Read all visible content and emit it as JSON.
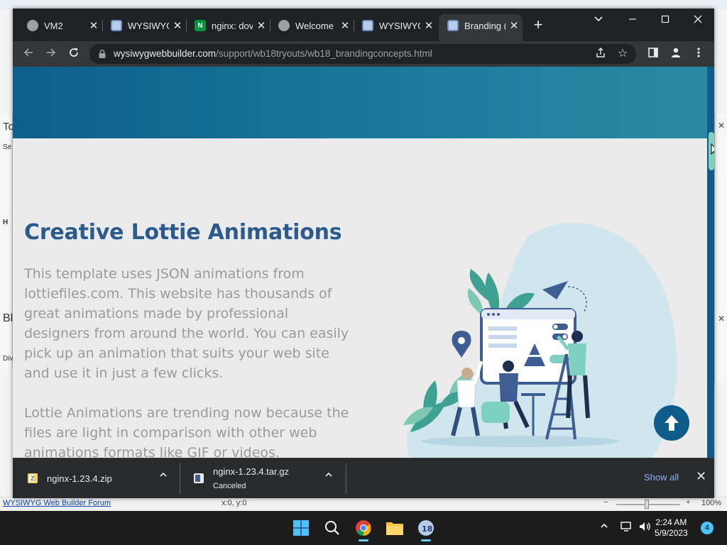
{
  "window": {
    "minimize_icon": "minimize-icon",
    "maximize_icon": "maximize-icon",
    "close_icon": "close-icon"
  },
  "tabs": [
    {
      "title": "VM2",
      "favicon": "globe-icon",
      "active": false
    },
    {
      "title": "WYSIWYG",
      "favicon": "wysiwyg-icon",
      "active": false
    },
    {
      "title": "nginx: dov",
      "favicon": "nginx-icon",
      "active": false
    },
    {
      "title": "Welcome",
      "favicon": "globe-icon",
      "active": false
    },
    {
      "title": "WYSIWYG",
      "favicon": "wysiwyg-icon",
      "active": false
    },
    {
      "title": "Branding (",
      "favicon": "wysiwyg-icon",
      "active": true
    }
  ],
  "toolbar": {
    "url_host": "wysiwygwebbuilder.com",
    "url_path": "/support/wb18tryouts/wb18_brandingconcepts.html"
  },
  "page": {
    "heading": "Creative Lottie Animations",
    "paragraph1": "This template uses JSON animations from lottiefiles.com. This website has thousands of great animations made by professional designers from around the world. You can easily pick up an animation that suits your web site and use it in just a few clicks.",
    "paragraph2": "Lottie Animations are trending now because the files are light in comparison with other web animations formats like GIF or videos."
  },
  "downloads": [
    {
      "filename": "nginx-1.23.4.zip",
      "status": ""
    },
    {
      "filename": "nginx-1.23.4.tar.gz",
      "status": "Canceled"
    }
  ],
  "downloads_show_all": "Show all",
  "background_app": {
    "forum_link": "WYSIWYG Web Builder Forum",
    "coords": "x:0, y:0",
    "zoom": "100%",
    "left_labels": [
      "To",
      "Se",
      "H",
      "Bl",
      "Div"
    ]
  },
  "taskbar": {
    "time": "2:24 AM",
    "date": "5/9/2023",
    "notification_count": "4",
    "colors": {
      "accent": "#60cdff"
    }
  },
  "colors": {
    "heading": "#2b5a8c",
    "hero_band": "#0c5f8a",
    "back_to_top": "#0d5c8c",
    "body_text": "#9a9a9a"
  }
}
